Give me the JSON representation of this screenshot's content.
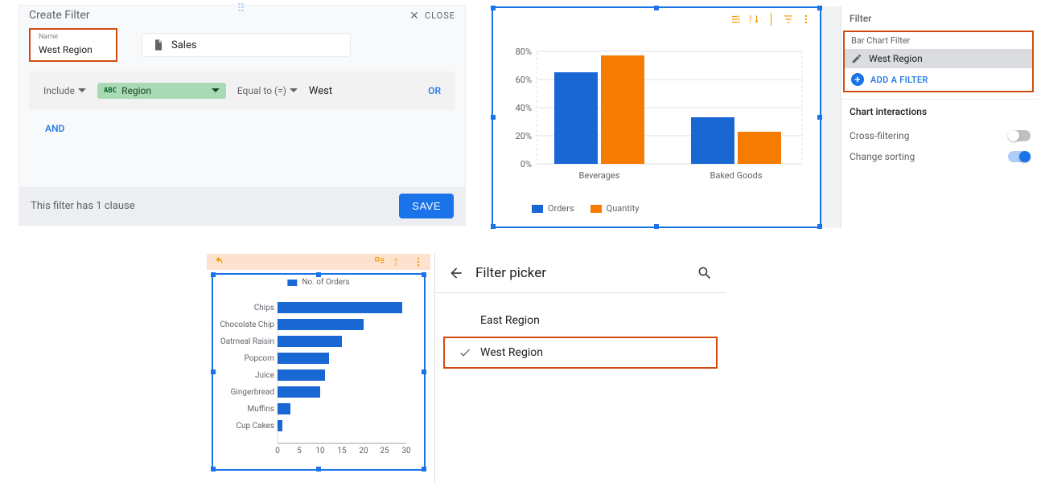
{
  "createFilter": {
    "title": "Create Filter",
    "close": "CLOSE",
    "nameLabel": "Name",
    "nameValue": "West Region",
    "dataSource": "Sales",
    "clause": {
      "include": "Include",
      "fieldChipPrefix": "ABC",
      "field": "Region",
      "condition": "Equal to (=)",
      "value": "West",
      "or": "OR"
    },
    "and": "AND",
    "footerMsg": "This filter has 1 clause",
    "save": "SAVE"
  },
  "barChartPanel": {
    "legend": {
      "series1": "Orders",
      "series2": "Quantity"
    },
    "side": {
      "heading": "Filter",
      "sub": "Bar Chart Filter",
      "itemLabel": "West Region",
      "add": "ADD A FILTER",
      "section2": "Chart interactions",
      "cross": "Cross-filtering",
      "sort": "Change sorting"
    }
  },
  "hbar": {
    "legend": "No. of Orders"
  },
  "filterPicker": {
    "title": "Filter picker",
    "opt1": "East Region",
    "opt2": "West Region"
  },
  "chart_data": [
    {
      "type": "bar",
      "title": "",
      "categories": [
        "Beverages",
        "Baked Goods"
      ],
      "series": [
        {
          "name": "Orders",
          "values": [
            65,
            33
          ]
        },
        {
          "name": "Quantity",
          "values": [
            77,
            23
          ]
        }
      ],
      "ylabel": "",
      "ylim": [
        0,
        80
      ],
      "y_ticks": [
        "0%",
        "20%",
        "40%",
        "60%",
        "80%"
      ],
      "orientation": "vertical"
    },
    {
      "type": "bar",
      "title": "",
      "orientation": "horizontal",
      "xlabel": "",
      "xlim": [
        0,
        30
      ],
      "x_ticks": [
        0,
        5,
        10,
        15,
        20,
        25,
        30
      ],
      "series": [
        {
          "name": "No. of Orders",
          "categories": [
            "Chips",
            "Chocolate Chip",
            "Oatmeal Raisin",
            "Popcorn",
            "Juice",
            "Gingerbread",
            "Muffins",
            "Cup Cakes"
          ],
          "values": [
            29,
            20,
            15,
            12,
            11,
            10,
            3,
            1
          ]
        }
      ]
    }
  ]
}
